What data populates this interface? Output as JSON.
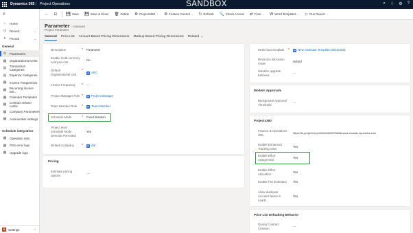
{
  "app": {
    "name": "Dynamics 365",
    "area": "Project Operations",
    "environment": "SANDBOX"
  },
  "topbar_icons": [
    "search-icon",
    "lightbulb-icon",
    "settings-icon",
    "help-icon"
  ],
  "commands": [
    {
      "icon": "←",
      "label": ""
    },
    {
      "icon": "⊡",
      "label": ""
    },
    {
      "icon": "💾",
      "label": "Save"
    },
    {
      "icon": "💾",
      "label": "Save & Close"
    },
    {
      "icon": "🗑",
      "label": "Delete"
    },
    {
      "icon": "⚙",
      "label": "Projects360",
      "caret": true
    },
    {
      "icon": "⚙",
      "label": "Feature Control",
      "caret": true
    },
    {
      "icon": "↻",
      "label": "Refresh"
    },
    {
      "icon": "🔍",
      "label": "Check Access"
    },
    {
      "icon": "⇄",
      "label": "Flow",
      "caret": true
    },
    {
      "icon": "W",
      "label": "Word Templates",
      "caret": true
    },
    {
      "icon": "▷",
      "label": "Run Report",
      "caret": true
    }
  ],
  "sidebar": {
    "top": [
      {
        "icon": "⌂",
        "label": "Home"
      },
      {
        "icon": "◷",
        "label": "Recent",
        "chev": "⌄"
      },
      {
        "icon": "✦",
        "label": "Pinned",
        "chev": "⌄"
      }
    ],
    "general_heading": "General",
    "general": [
      {
        "icon": "⚙",
        "label": "Parameters",
        "active": true
      },
      {
        "icon": "▦",
        "label": "Organizational Units"
      },
      {
        "icon": "▤",
        "label": "Transaction Categories"
      },
      {
        "icon": "▤",
        "label": "Expense Categories"
      },
      {
        "icon": "▦",
        "label": "Invoice Frequencies"
      },
      {
        "icon": "▦",
        "label": "Recurring Invoice Set..."
      },
      {
        "icon": "▦",
        "label": "Calendar Templates"
      },
      {
        "icon": "▦",
        "label": "Contract reason codes"
      },
      {
        "icon": "▦",
        "label": "Company Parameters"
      },
      {
        "icon": "▦",
        "label": "Autonumber settings"
      }
    ],
    "schedule_heading": "Schedule integration",
    "schedule": [
      {
        "icon": "▦",
        "label": "Operation sets"
      },
      {
        "icon": "▦",
        "label": "PSS error logs"
      },
      {
        "icon": "▦",
        "label": "Upgrade logs"
      }
    ],
    "area_badge": "S",
    "area_label": "Settings",
    "area_chev": "⌃"
  },
  "header": {
    "title": "Parameter",
    "saved": "- Unsaved",
    "subtitle": "Project Parameter",
    "tabs": [
      {
        "label": "General",
        "active": true
      },
      {
        "label": "Price List"
      },
      {
        "label": "Amount Based Pricing Dimensions"
      },
      {
        "label": "Markup Based Pricing Dimensions"
      },
      {
        "label": "Related",
        "caret": "⌄"
      }
    ]
  },
  "left_fields": [
    {
      "label": "Description",
      "required": true,
      "value": "Parameter"
    },
    {
      "label": "Enable multi-currency\ncost price list",
      "value": "No"
    },
    {
      "label": "Default\nOrganizational Unit",
      "required": true,
      "value": "AEC",
      "link": true,
      "icon": "org"
    },
    {
      "label": "Invoice Frequency",
      "required": true,
      "value": "---",
      "dash": true
    },
    {
      "label": "Project Manager Role",
      "required": true,
      "value": "Project Manager",
      "link": true,
      "icon": "lookup"
    },
    {
      "label": "Team Member Role",
      "required": true,
      "value": "Team Member",
      "link": true,
      "icon": "lookup"
    },
    {
      "label": "Schedule Mode",
      "required": true,
      "value": "Fixed duration",
      "highlight": true
    },
    {
      "label": "Project level\nSchedule Mode\nOverride Permitted",
      "value": "Yes"
    },
    {
      "label": "Default Company",
      "required": true,
      "value": "dat",
      "link": true,
      "icon": "lookup"
    }
  ],
  "pricing": {
    "title": "Pricing",
    "fields": [
      {
        "label": "Estimate pricing\noptions",
        "value": "---",
        "dash": true
      }
    ]
  },
  "right_top": [
    {
      "label": "Work hour template",
      "required": true,
      "value": "New Calendar Template 05/21/2021",
      "link": true,
      "icon": "lookup"
    },
    {
      "label": "Resource allocation\nmode",
      "value": "Hybrid"
    },
    {
      "label": "Solution upgrade\nbehavior",
      "value": "---",
      "dash": true
    }
  ],
  "modern_approvals": {
    "title": "Modern Approvals",
    "fields": [
      {
        "label": "Background Approval\nThreshold",
        "value": "---",
        "dash": true
      }
    ]
  },
  "projects360": {
    "title": "Projects360",
    "fields": [
      {
        "label": "Finance & Operations\nURL",
        "value": "https://fo-projteim-hpo22ebb09e3578d9devaos.cloudax.dynamics.com"
      },
      {
        "label": "Enable Enhanced\nTracking View",
        "value": "Yes"
      },
      {
        "label": "Enable Effort\nAssignment",
        "value": "Yes",
        "highlight": true
      },
      {
        "label": "Enable Effort\nAllocation",
        "value": "Yes"
      },
      {
        "label": "Enable Fee Estimator",
        "value": "Yes"
      },
      {
        "label": "Allow duplicate\nAccount Name in\nLeads",
        "value": "Yes"
      }
    ]
  },
  "price_list_defaulting": {
    "title": "Price List Defaulting Behavior",
    "fields": [
      {
        "label": "During Contract\nCreation",
        "value": "---",
        "dash": true
      }
    ]
  },
  "colors": {
    "highlight": "#2e9b3d",
    "link": "#0f6cbd",
    "topbar": "#0b1a2e"
  }
}
